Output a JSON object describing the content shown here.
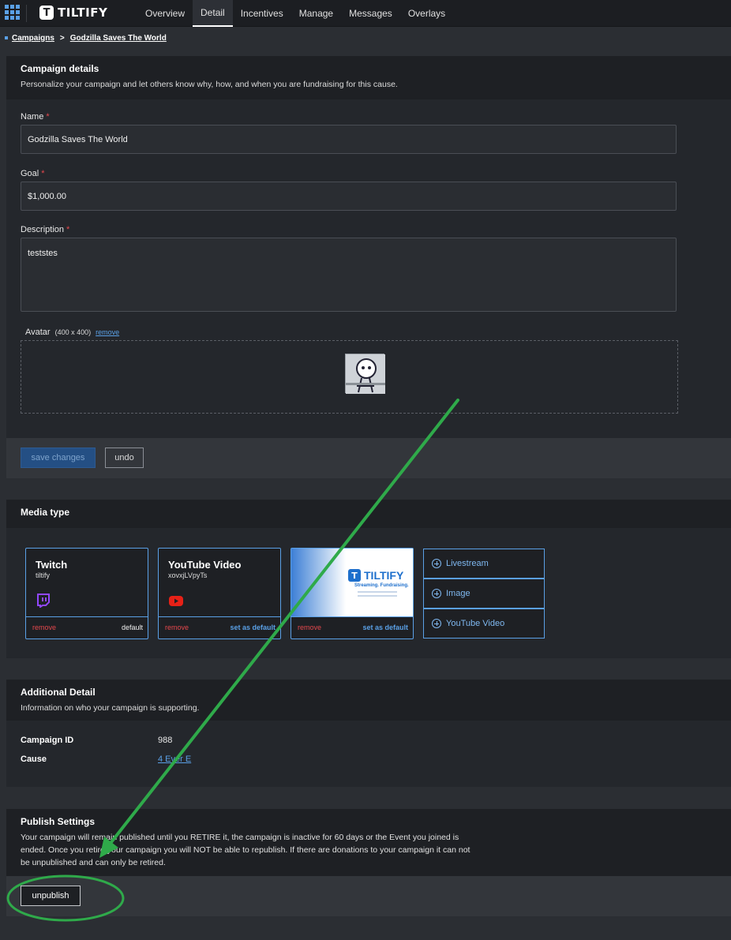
{
  "header": {
    "logo_text": "TILTIFY",
    "nav": [
      {
        "label": "Overview"
      },
      {
        "label": "Detail"
      },
      {
        "label": "Incentives"
      },
      {
        "label": "Manage"
      },
      {
        "label": "Messages"
      },
      {
        "label": "Overlays"
      }
    ],
    "active_tab": "Detail"
  },
  "breadcrumb": {
    "root": "Campaigns",
    "separator": ">",
    "current": "Godzilla Saves The World"
  },
  "campaign_details": {
    "title": "Campaign details",
    "subtitle": "Personalize your campaign and let others know why, how, and when you are fundraising for this cause.",
    "name_label": "Name",
    "name_value": "Godzilla Saves The World",
    "goal_label": "Goal",
    "goal_value": "$1,000.00",
    "description_label": "Description",
    "description_value": "teststes",
    "required_mark": "*",
    "avatar_label": "Avatar",
    "avatar_dims": "(400 x 400)",
    "avatar_remove": "remove",
    "save_label": "save changes",
    "undo_label": "undo"
  },
  "media_type": {
    "title": "Media type",
    "cards": [
      {
        "title": "Twitch",
        "subtitle": "tiltify",
        "remove": "remove",
        "action": "default",
        "icon": "twitch-icon"
      },
      {
        "title": "YouTube Video",
        "subtitle": "xovxjLVpyTs",
        "remove": "remove",
        "action": "set as default",
        "icon": "youtube-icon"
      },
      {
        "thumb_logo": "TILTIFY",
        "thumb_tag": "Streaming. Fundraising.",
        "remove": "remove",
        "action": "set as default"
      }
    ],
    "add_buttons": [
      {
        "label": "Livestream"
      },
      {
        "label": "Image"
      },
      {
        "label": "YouTube Video"
      }
    ]
  },
  "additional_detail": {
    "title": "Additional Detail",
    "subtitle": "Information on who your campaign is supporting.",
    "campaign_id_label": "Campaign ID",
    "campaign_id_value": "988",
    "cause_label": "Cause",
    "cause_value": "4 Ever E"
  },
  "publish_settings": {
    "title": "Publish Settings",
    "text": "Your campaign will remain published until you RETIRE it, the campaign is inactive for 60 days or the Event you joined is ended. Once you retire your campaign you will NOT be able to republish. If there are donations to your campaign it can not be unpublished and can only be retired.",
    "unpublish_label": "unpublish"
  },
  "colors": {
    "accent": "#5aa0e6",
    "annotation": "#2faa4a",
    "required": "#e5484d"
  }
}
